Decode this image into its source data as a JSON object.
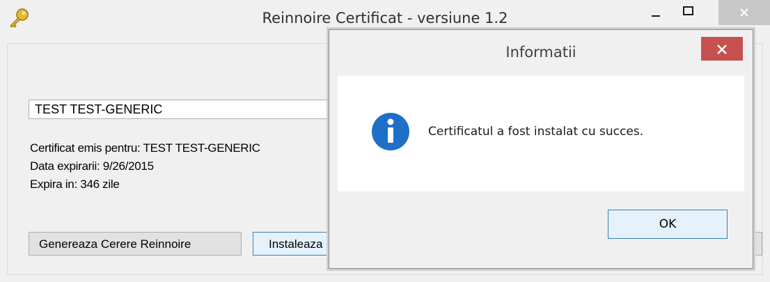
{
  "window": {
    "title": "Reinnoire Certificat - versiune 1.2",
    "icon": "key-icon",
    "controls": [
      "minimize-icon",
      "maximize-icon",
      "close-icon"
    ]
  },
  "main": {
    "certificate_select_value": "TEST TEST-GENERIC",
    "info": {
      "issued_for": "Certificat emis pentru: TEST TEST-GENERIC",
      "expiry_date": "Data expirarii: 9/26/2015",
      "expires_in": "Expira in: 346 zile"
    },
    "buttons": {
      "generate": "Genereaza Cerere Reinnoire",
      "install": "Instaleaza"
    }
  },
  "dialog": {
    "title": "Informatii",
    "icon": "info-icon",
    "message": "Certificatul a fost instalat cu succes.",
    "ok_label": "OK",
    "accent_colors": {
      "close": "#c75050",
      "info_icon": "#1e6fc8"
    }
  }
}
